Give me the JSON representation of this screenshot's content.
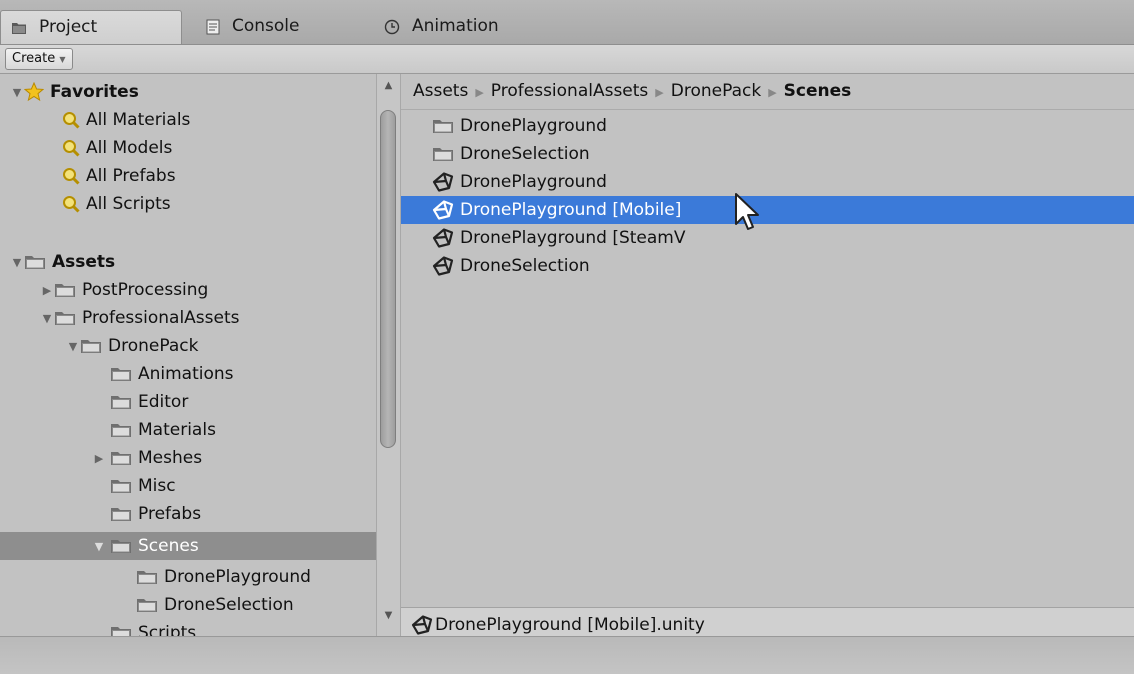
{
  "tabs": [
    {
      "label": "Project",
      "icon": "folder-icon",
      "active": true
    },
    {
      "label": "Console",
      "icon": "console-icon",
      "active": false
    },
    {
      "label": "Animation",
      "icon": "clock-icon",
      "active": false
    }
  ],
  "toolbar": {
    "create_label": "Create"
  },
  "favorites": {
    "header": "Favorites",
    "items": [
      "All Materials",
      "All Models",
      "All Prefabs",
      "All Scripts"
    ]
  },
  "assets": {
    "header": "Assets",
    "tree": [
      {
        "label": "PostProcessing",
        "has_children": true,
        "expanded": false
      },
      {
        "label": "ProfessionalAssets",
        "has_children": true,
        "expanded": true
      },
      {
        "label": "DronePack",
        "has_children": true,
        "expanded": true
      },
      {
        "label": "Animations"
      },
      {
        "label": "Editor"
      },
      {
        "label": "Materials"
      },
      {
        "label": "Meshes",
        "has_children": true,
        "expanded": false
      },
      {
        "label": "Misc"
      },
      {
        "label": "Prefabs"
      },
      {
        "label": "Scenes",
        "has_children": true,
        "expanded": true,
        "selected": true
      },
      {
        "label": "DronePlayground"
      },
      {
        "label": "DroneSelection"
      },
      {
        "label": "Scripts"
      }
    ]
  },
  "breadcrumb": [
    "Assets",
    "ProfessionalAssets",
    "DronePack",
    "Scenes"
  ],
  "files": [
    {
      "label": "DronePlayground",
      "type": "folder"
    },
    {
      "label": "DroneSelection",
      "type": "folder"
    },
    {
      "label": "DronePlayground",
      "type": "scene"
    },
    {
      "label": "DronePlayground [Mobile]",
      "type": "scene",
      "selected": true
    },
    {
      "label": "DronePlayground [SteamV",
      "type": "scene"
    },
    {
      "label": "DroneSelection",
      "type": "scene"
    }
  ],
  "status": {
    "selected_file": "DronePlayground [Mobile].unity"
  },
  "colors": {
    "selection_blue": "#3b7ad9",
    "tree_selected": "#8e8e8e",
    "panel_bg": "#c2c2c2"
  }
}
